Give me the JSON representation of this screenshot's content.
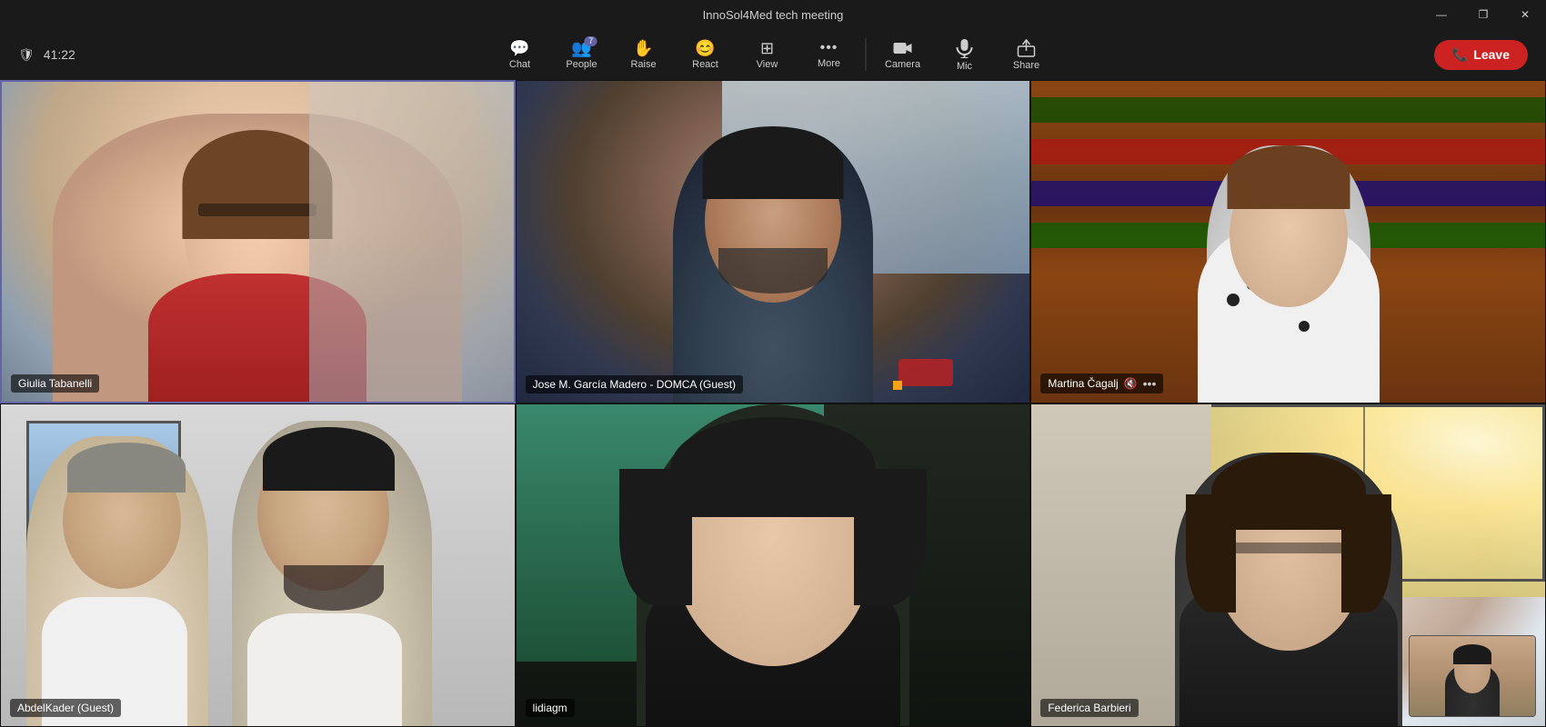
{
  "window": {
    "title": "InnoSol4Med tech meeting"
  },
  "window_controls": {
    "minimize": "—",
    "maximize": "❐",
    "close": "✕"
  },
  "toolbar": {
    "timer": "41:22",
    "buttons": [
      {
        "id": "chat",
        "label": "Chat",
        "icon": "💬",
        "badge": null
      },
      {
        "id": "people",
        "label": "People",
        "icon": "👥",
        "badge": "7"
      },
      {
        "id": "raise",
        "label": "Raise",
        "icon": "✋",
        "badge": null
      },
      {
        "id": "react",
        "label": "React",
        "icon": "😊",
        "badge": null
      },
      {
        "id": "view",
        "label": "View",
        "icon": "⊞",
        "badge": null
      },
      {
        "id": "more",
        "label": "More",
        "icon": "•••",
        "badge": null
      },
      {
        "id": "camera",
        "label": "Camera",
        "icon": "📹",
        "badge": null
      },
      {
        "id": "mic",
        "label": "Mic",
        "icon": "🎤",
        "badge": null
      },
      {
        "id": "share",
        "label": "Share",
        "icon": "⬆",
        "badge": null
      }
    ],
    "leave_label": "Leave",
    "leave_icon": "📞"
  },
  "participants": [
    {
      "id": "giulia",
      "name": "Giulia Tabanelli",
      "muted": false,
      "active_speaker": true,
      "position": "top-left"
    },
    {
      "id": "jose",
      "name": "Jose M. García Madero - DOMCA (Guest)",
      "muted": false,
      "active_speaker": false,
      "position": "top-middle"
    },
    {
      "id": "martina",
      "name": "Martina Čagalj",
      "muted": true,
      "active_speaker": false,
      "position": "top-right"
    },
    {
      "id": "abdelkader",
      "name": "AbdelKader (Guest)",
      "muted": false,
      "active_speaker": false,
      "position": "bottom-left"
    },
    {
      "id": "lidiagm",
      "name": "lidiagm",
      "muted": false,
      "active_speaker": false,
      "position": "bottom-middle"
    },
    {
      "id": "federica",
      "name": "Federica Barbieri",
      "muted": false,
      "active_speaker": false,
      "position": "bottom-right"
    }
  ],
  "colors": {
    "active_speaker_border": "#6264a7",
    "leave_button": "#cc2222",
    "toolbar_bg": "#1a1a1a",
    "badge_bg": "#6264a7"
  }
}
